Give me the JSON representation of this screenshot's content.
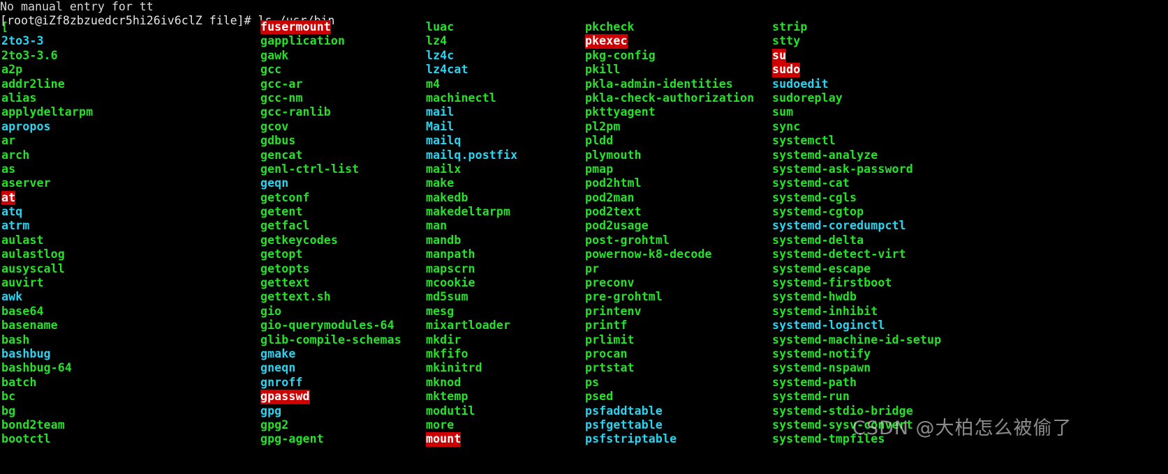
{
  "terminal": {
    "background": "#000000",
    "colors": {
      "exec": "#26e02a",
      "symlink": "#2ad4f0",
      "setuid_fg": "#ffffff",
      "setuid_bg": "#cc0000",
      "plain": "#d8d8d8"
    },
    "scrollback_line": "No manual entry for tt",
    "prompt": {
      "text": "[root@iZf8zbzuedcr5hi26iv6clZ file]# ls /usr/bin",
      "user": "root",
      "host": "iZf8zbzuedcr5hi26iv6clZ",
      "cwd": "file",
      "symbol": "#",
      "command": "ls /usr/bin"
    }
  },
  "watermark": {
    "text": "CSDN @大柏怎么被偷了"
  },
  "listing": {
    "path": "/usr/bin",
    "columns": [
      {
        "index": 0,
        "entries": [
          {
            "name": "[",
            "type": "exec"
          },
          {
            "name": "2to3-3",
            "type": "symlink"
          },
          {
            "name": "2to3-3.6",
            "type": "exec"
          },
          {
            "name": "a2p",
            "type": "exec"
          },
          {
            "name": "addr2line",
            "type": "exec"
          },
          {
            "name": "alias",
            "type": "exec"
          },
          {
            "name": "applydeltarpm",
            "type": "exec"
          },
          {
            "name": "apropos",
            "type": "symlink"
          },
          {
            "name": "ar",
            "type": "exec"
          },
          {
            "name": "arch",
            "type": "exec"
          },
          {
            "name": "as",
            "type": "exec"
          },
          {
            "name": "aserver",
            "type": "exec"
          },
          {
            "name": "at",
            "type": "setuid"
          },
          {
            "name": "atq",
            "type": "symlink"
          },
          {
            "name": "atrm",
            "type": "symlink"
          },
          {
            "name": "aulast",
            "type": "exec"
          },
          {
            "name": "aulastlog",
            "type": "exec"
          },
          {
            "name": "ausyscall",
            "type": "exec"
          },
          {
            "name": "auvirt",
            "type": "exec"
          },
          {
            "name": "awk",
            "type": "symlink"
          },
          {
            "name": "base64",
            "type": "exec"
          },
          {
            "name": "basename",
            "type": "exec"
          },
          {
            "name": "bash",
            "type": "exec"
          },
          {
            "name": "bashbug",
            "type": "symlink"
          },
          {
            "name": "bashbug-64",
            "type": "exec"
          },
          {
            "name": "batch",
            "type": "exec"
          },
          {
            "name": "bc",
            "type": "exec"
          },
          {
            "name": "bg",
            "type": "exec"
          },
          {
            "name": "bond2team",
            "type": "exec"
          },
          {
            "name": "bootctl",
            "type": "exec"
          }
        ]
      },
      {
        "index": 1,
        "entries": [
          {
            "name": "fusermount",
            "type": "setuid"
          },
          {
            "name": "gapplication",
            "type": "exec"
          },
          {
            "name": "gawk",
            "type": "exec"
          },
          {
            "name": "gcc",
            "type": "exec"
          },
          {
            "name": "gcc-ar",
            "type": "exec"
          },
          {
            "name": "gcc-nm",
            "type": "exec"
          },
          {
            "name": "gcc-ranlib",
            "type": "exec"
          },
          {
            "name": "gcov",
            "type": "exec"
          },
          {
            "name": "gdbus",
            "type": "exec"
          },
          {
            "name": "gencat",
            "type": "exec"
          },
          {
            "name": "genl-ctrl-list",
            "type": "exec"
          },
          {
            "name": "geqn",
            "type": "symlink"
          },
          {
            "name": "getconf",
            "type": "exec"
          },
          {
            "name": "getent",
            "type": "exec"
          },
          {
            "name": "getfacl",
            "type": "exec"
          },
          {
            "name": "getkeycodes",
            "type": "exec"
          },
          {
            "name": "getopt",
            "type": "exec"
          },
          {
            "name": "getopts",
            "type": "exec"
          },
          {
            "name": "gettext",
            "type": "exec"
          },
          {
            "name": "gettext.sh",
            "type": "exec"
          },
          {
            "name": "gio",
            "type": "exec"
          },
          {
            "name": "gio-querymodules-64",
            "type": "exec"
          },
          {
            "name": "glib-compile-schemas",
            "type": "exec"
          },
          {
            "name": "gmake",
            "type": "symlink"
          },
          {
            "name": "gneqn",
            "type": "symlink"
          },
          {
            "name": "gnroff",
            "type": "symlink"
          },
          {
            "name": "gpasswd",
            "type": "setuid"
          },
          {
            "name": "gpg",
            "type": "symlink"
          },
          {
            "name": "gpg2",
            "type": "exec"
          },
          {
            "name": "gpg-agent",
            "type": "exec"
          }
        ]
      },
      {
        "index": 2,
        "entries": [
          {
            "name": "luac",
            "type": "exec"
          },
          {
            "name": "lz4",
            "type": "exec"
          },
          {
            "name": "lz4c",
            "type": "symlink"
          },
          {
            "name": "lz4cat",
            "type": "symlink"
          },
          {
            "name": "m4",
            "type": "exec"
          },
          {
            "name": "machinectl",
            "type": "exec"
          },
          {
            "name": "mail",
            "type": "symlink"
          },
          {
            "name": "Mail",
            "type": "symlink"
          },
          {
            "name": "mailq",
            "type": "symlink"
          },
          {
            "name": "mailq.postfix",
            "type": "symlink"
          },
          {
            "name": "mailx",
            "type": "exec"
          },
          {
            "name": "make",
            "type": "exec"
          },
          {
            "name": "makedb",
            "type": "exec"
          },
          {
            "name": "makedeltarpm",
            "type": "exec"
          },
          {
            "name": "man",
            "type": "exec"
          },
          {
            "name": "mandb",
            "type": "exec"
          },
          {
            "name": "manpath",
            "type": "exec"
          },
          {
            "name": "mapscrn",
            "type": "exec"
          },
          {
            "name": "mcookie",
            "type": "exec"
          },
          {
            "name": "md5sum",
            "type": "exec"
          },
          {
            "name": "mesg",
            "type": "exec"
          },
          {
            "name": "mixartloader",
            "type": "exec"
          },
          {
            "name": "mkdir",
            "type": "exec"
          },
          {
            "name": "mkfifo",
            "type": "exec"
          },
          {
            "name": "mkinitrd",
            "type": "exec"
          },
          {
            "name": "mknod",
            "type": "exec"
          },
          {
            "name": "mktemp",
            "type": "exec"
          },
          {
            "name": "modutil",
            "type": "exec"
          },
          {
            "name": "more",
            "type": "exec"
          },
          {
            "name": "mount",
            "type": "setuid"
          }
        ]
      },
      {
        "index": 3,
        "entries": [
          {
            "name": "pkcheck",
            "type": "exec"
          },
          {
            "name": "pkexec",
            "type": "setuid"
          },
          {
            "name": "pkg-config",
            "type": "exec"
          },
          {
            "name": "pkill",
            "type": "exec"
          },
          {
            "name": "pkla-admin-identities",
            "type": "exec"
          },
          {
            "name": "pkla-check-authorization",
            "type": "exec"
          },
          {
            "name": "pkttyagent",
            "type": "exec"
          },
          {
            "name": "pl2pm",
            "type": "exec"
          },
          {
            "name": "pldd",
            "type": "exec"
          },
          {
            "name": "plymouth",
            "type": "exec"
          },
          {
            "name": "pmap",
            "type": "exec"
          },
          {
            "name": "pod2html",
            "type": "exec"
          },
          {
            "name": "pod2man",
            "type": "exec"
          },
          {
            "name": "pod2text",
            "type": "exec"
          },
          {
            "name": "pod2usage",
            "type": "exec"
          },
          {
            "name": "post-grohtml",
            "type": "exec"
          },
          {
            "name": "powernow-k8-decode",
            "type": "exec"
          },
          {
            "name": "pr",
            "type": "exec"
          },
          {
            "name": "preconv",
            "type": "exec"
          },
          {
            "name": "pre-grohtml",
            "type": "exec"
          },
          {
            "name": "printenv",
            "type": "exec"
          },
          {
            "name": "printf",
            "type": "exec"
          },
          {
            "name": "prlimit",
            "type": "exec"
          },
          {
            "name": "procan",
            "type": "exec"
          },
          {
            "name": "prtstat",
            "type": "exec"
          },
          {
            "name": "ps",
            "type": "exec"
          },
          {
            "name": "psed",
            "type": "exec"
          },
          {
            "name": "psfaddtable",
            "type": "symlink"
          },
          {
            "name": "psfgettable",
            "type": "symlink"
          },
          {
            "name": "psfstriptable",
            "type": "symlink"
          }
        ]
      },
      {
        "index": 4,
        "entries": [
          {
            "name": "strip",
            "type": "exec"
          },
          {
            "name": "stty",
            "type": "exec"
          },
          {
            "name": "su",
            "type": "setuid"
          },
          {
            "name": "sudo",
            "type": "setuid"
          },
          {
            "name": "sudoedit",
            "type": "symlink"
          },
          {
            "name": "sudoreplay",
            "type": "exec"
          },
          {
            "name": "sum",
            "type": "exec"
          },
          {
            "name": "sync",
            "type": "exec"
          },
          {
            "name": "systemctl",
            "type": "exec"
          },
          {
            "name": "systemd-analyze",
            "type": "exec"
          },
          {
            "name": "systemd-ask-password",
            "type": "exec"
          },
          {
            "name": "systemd-cat",
            "type": "exec"
          },
          {
            "name": "systemd-cgls",
            "type": "exec"
          },
          {
            "name": "systemd-cgtop",
            "type": "exec"
          },
          {
            "name": "systemd-coredumpctl",
            "type": "symlink"
          },
          {
            "name": "systemd-delta",
            "type": "exec"
          },
          {
            "name": "systemd-detect-virt",
            "type": "exec"
          },
          {
            "name": "systemd-escape",
            "type": "exec"
          },
          {
            "name": "systemd-firstboot",
            "type": "exec"
          },
          {
            "name": "systemd-hwdb",
            "type": "exec"
          },
          {
            "name": "systemd-inhibit",
            "type": "exec"
          },
          {
            "name": "systemd-loginctl",
            "type": "symlink"
          },
          {
            "name": "systemd-machine-id-setup",
            "type": "exec"
          },
          {
            "name": "systemd-notify",
            "type": "exec"
          },
          {
            "name": "systemd-nspawn",
            "type": "exec"
          },
          {
            "name": "systemd-path",
            "type": "exec"
          },
          {
            "name": "systemd-run",
            "type": "exec"
          },
          {
            "name": "systemd-stdio-bridge",
            "type": "exec"
          },
          {
            "name": "systemd-sysv-convert",
            "type": "exec"
          },
          {
            "name": "systemd-tmpfiles",
            "type": "exec"
          }
        ]
      }
    ]
  }
}
